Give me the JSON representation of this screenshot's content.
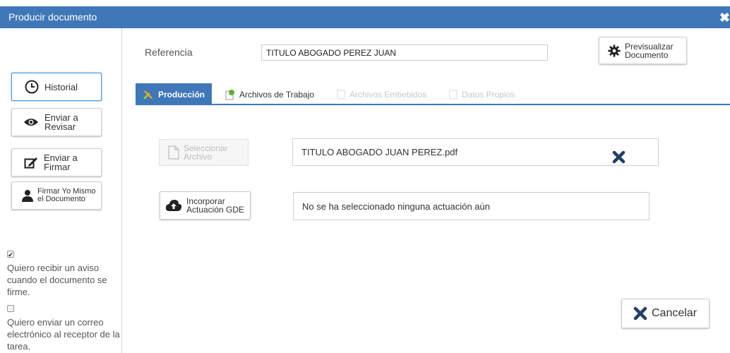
{
  "window": {
    "title": "Producir documento",
    "close_symbol": "✖"
  },
  "sidebar": {
    "historial": "Historial",
    "enviar_revisar_line1": "Enviar a",
    "enviar_revisar_line2": "Revisar",
    "enviar_firmar_line1": "Enviar a",
    "enviar_firmar_line2": "Firmar",
    "firmar_yo_line1": "Firmar Yo Mismo",
    "firmar_yo_line2": "el Documento",
    "aviso_checked": true,
    "aviso_text": "Quiero recibir un aviso cuando el documento se firme.",
    "correo_checked": false,
    "correo_text": "Quiero enviar un correo electrónico al receptor de la tarea."
  },
  "header": {
    "referencia_label": "Referencia",
    "referencia_value": "TITULO ABOGADO PEREZ JUAN",
    "previsualizar_line1": "Previsualizar",
    "previsualizar_line2": "Documento"
  },
  "tabs": [
    {
      "label": "Producción",
      "state": "active"
    },
    {
      "label": "Archivos de Trabajo",
      "state": "enabled"
    },
    {
      "label": "Archivos Embebidos",
      "state": "disabled"
    },
    {
      "label": "Datos Propios",
      "state": "disabled"
    }
  ],
  "produccion": {
    "seleccionar_line1": "Seleccionar",
    "seleccionar_line2": "Archivo",
    "selected_file": "TITULO ABOGADO JUAN PEREZ.pdf",
    "incorporar_line1": "Incorporar",
    "incorporar_line2": "Actuación GDE",
    "actuacion_status": "No se ha seleccionado ninguna actuación aún"
  },
  "footer": {
    "cancelar": "Cancelar"
  },
  "colors": {
    "primary": "#3f77b9",
    "remove_x": "#1f3f66"
  },
  "icons": {
    "clock": "clock-icon",
    "eye": "eye-icon",
    "sign": "pen-icon",
    "user": "user-icon",
    "gear": "gear-icon",
    "tools": "tools-icon",
    "paperclip": "paperclip-icon",
    "file": "file-icon",
    "cloud": "cloud-upload-icon",
    "remove": "close-icon"
  }
}
